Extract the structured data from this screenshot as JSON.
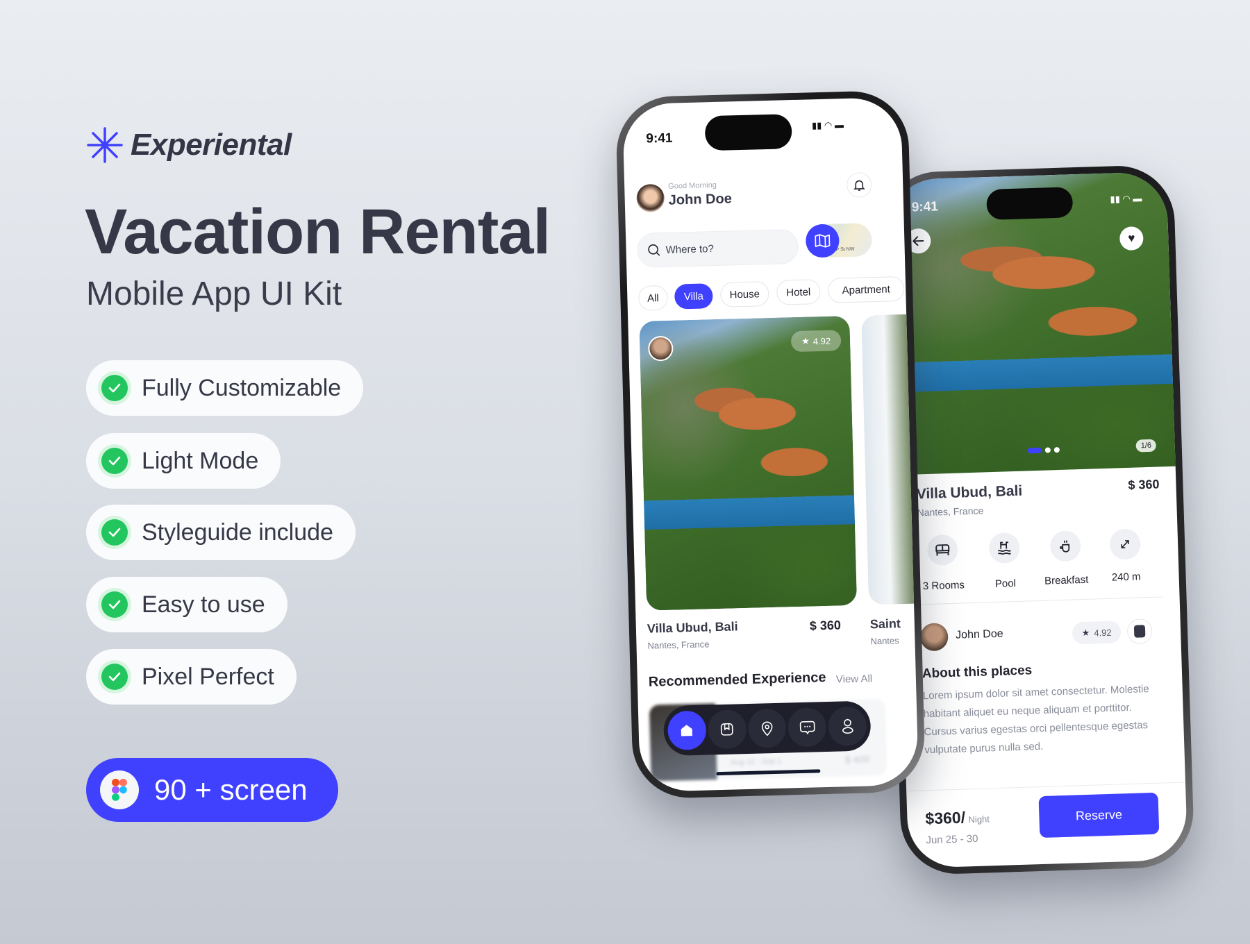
{
  "brand": {
    "name": "Experiental",
    "accent": "#4040ff"
  },
  "hero": {
    "title": "Vacation Rental",
    "subtitle": "Mobile App UI Kit"
  },
  "features": [
    {
      "label": "Fully Customizable"
    },
    {
      "label": "Light Mode"
    },
    {
      "label": "Styleguide include"
    },
    {
      "label": "Easy to use"
    },
    {
      "label": "Pixel Perfect"
    }
  ],
  "cta": {
    "label": "90 + screen",
    "icon": "figma-icon"
  },
  "home_screen": {
    "time": "9:41",
    "greeting": "Good Morning",
    "user_name": "John Doe",
    "search_placeholder": "Where to?",
    "map_label": "P St NW",
    "categories": [
      {
        "label": "All"
      },
      {
        "label": "Villa",
        "active": true
      },
      {
        "label": "House"
      },
      {
        "label": "Hotel"
      },
      {
        "label": "Apartment"
      }
    ],
    "cards": [
      {
        "name": "Villa Ubud, Bali",
        "location": "Nantes, France",
        "price": "$ 360",
        "rating": "4.92"
      },
      {
        "name": "Saint",
        "location": "Nantes"
      }
    ],
    "section_title": "Recommended Experience",
    "view_all": "View All",
    "recommended_preview": {
      "dates": "Aug 12 - Sep 1",
      "price": "$ 400"
    },
    "nav": [
      "home-icon",
      "bookmark-icon",
      "location-icon",
      "chat-icon",
      "profile-icon"
    ]
  },
  "detail_screen": {
    "time": "9:41",
    "image_counter": "1/6",
    "name": "Villa Ubud, Bali",
    "location": "Nantes, France",
    "price": "$ 360",
    "amenities": [
      {
        "icon": "bed-icon",
        "label": "3 Rooms"
      },
      {
        "icon": "pool-icon",
        "label": "Pool"
      },
      {
        "icon": "coffee-icon",
        "label": "Breakfast"
      },
      {
        "icon": "expand-icon",
        "label": "240 m"
      }
    ],
    "host": {
      "name": "John Doe",
      "rating": "4.92"
    },
    "about_title": "About this places",
    "about_text": "Lorem ipsum dolor sit amet consectetur. Molestie habitant aliquet eu neque aliquam et porttitor. Cursus varius egestas orci pellentesque egestas vulputate purus nulla sed.",
    "footer": {
      "price": "$360/",
      "unit": "Night",
      "dates": "Jun 25 - 30",
      "reserve_label": "Reserve"
    }
  }
}
